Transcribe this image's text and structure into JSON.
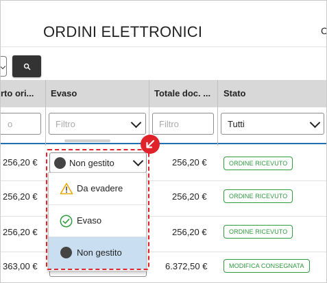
{
  "page": {
    "title": "ORDINI ELETTRONICI",
    "title_cutoff": "C"
  },
  "search": {
    "icon": "search-icon"
  },
  "columns": [
    {
      "label": "rto ori..."
    },
    {
      "label": "Evaso"
    },
    {
      "label": "Totale doc. ..."
    },
    {
      "label": "Stato"
    }
  ],
  "filters": {
    "col1_placeholder": "o",
    "evaso_placeholder": "Filtro",
    "totale_placeholder": "Filtro",
    "stato_value": "Tutti"
  },
  "rows": [
    {
      "importo": "256,20 €",
      "evaso": "Non gestito",
      "totale": "256,20 €",
      "stato": "ORDINE RICEVUTO"
    },
    {
      "importo": "256,20 €",
      "totale": "256,20 €",
      "stato": "ORDINE RICEVUTO"
    },
    {
      "importo": "256,20 €",
      "totale": "256,20 €",
      "stato": "ORDINE RICEVUTO"
    },
    {
      "importo": "363,00 €",
      "totale": "6.372,50 €",
      "stato": "MODIFICA CONSEGNATA"
    }
  ],
  "dropdown": {
    "options": [
      {
        "label": "Da evadere",
        "icon": "warning-icon"
      },
      {
        "label": "Evaso",
        "icon": "check-circle-icon"
      },
      {
        "label": "Non gestito",
        "icon": "dark-circle-icon",
        "selected": true
      }
    ]
  },
  "colors": {
    "accent_blue": "#1f6fb2",
    "badge_green": "#2e9b3e",
    "highlight_red": "#e0232a",
    "selected_bg": "#c9dff1",
    "warning_yellow": "#e8a800"
  }
}
